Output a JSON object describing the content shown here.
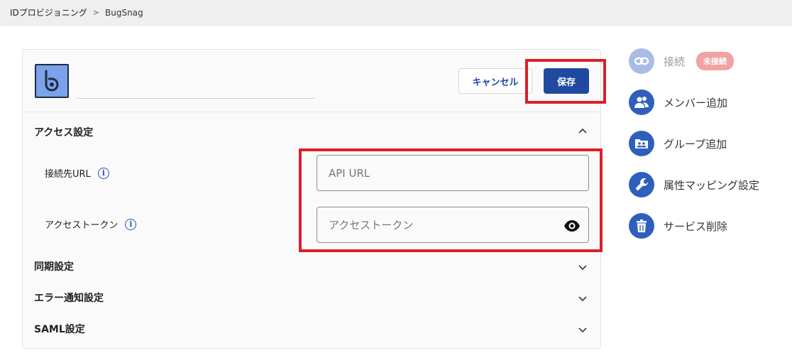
{
  "breadcrumb": {
    "parent": "IDプロビジョニング",
    "separator": ">",
    "current": "BugSnag"
  },
  "header": {
    "cancel_label": "キャンセル",
    "save_label": "保存"
  },
  "sections": {
    "access": {
      "title": "アクセス設定"
    },
    "sync": {
      "title": "同期設定"
    },
    "error": {
      "title": "エラー通知設定"
    },
    "saml": {
      "title": "SAML設定"
    }
  },
  "fields": {
    "url": {
      "label": "接続先URL",
      "placeholder": "API URL",
      "value": ""
    },
    "token": {
      "label": "アクセストークン",
      "placeholder": "アクセストークン",
      "value": ""
    }
  },
  "sidebar": {
    "connect": {
      "label": "接続",
      "badge": "未接続"
    },
    "add_member": {
      "label": "メンバー追加"
    },
    "add_group": {
      "label": "グループ追加"
    },
    "attr_mapping": {
      "label": "属性マッピング設定"
    },
    "delete": {
      "label": "サービス削除"
    }
  },
  "colors": {
    "primary": "#1f4aa0",
    "highlight": "#dd1e2a",
    "badge": "#f1a3a3",
    "logo": "#7ba2ea"
  }
}
